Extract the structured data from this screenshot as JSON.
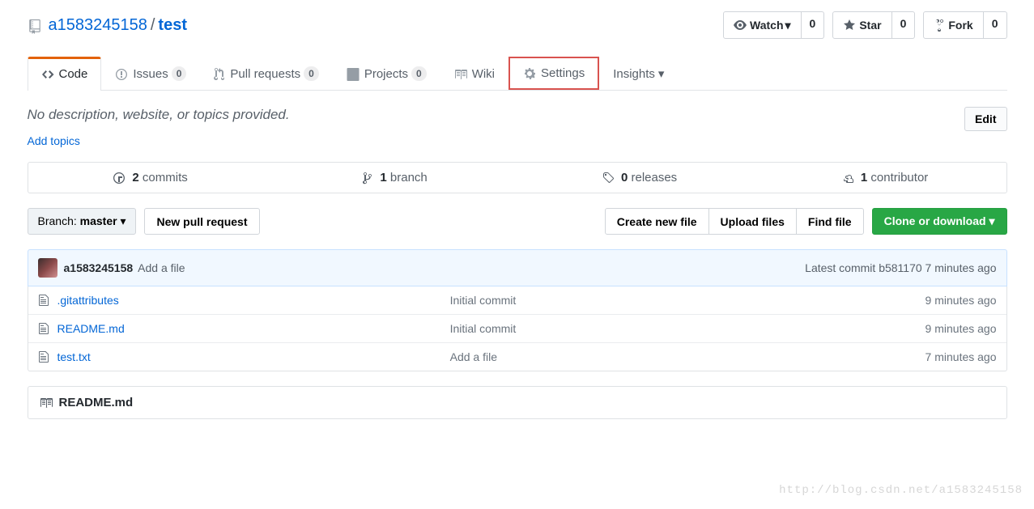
{
  "header": {
    "owner": "a1583245158",
    "sep": "/",
    "repo": "test",
    "watch_label": "Watch",
    "watch_count": "0",
    "star_label": "Star",
    "star_count": "0",
    "fork_label": "Fork",
    "fork_count": "0"
  },
  "tabs": {
    "code": "Code",
    "issues": "Issues",
    "issues_count": "0",
    "pulls": "Pull requests",
    "pulls_count": "0",
    "projects": "Projects",
    "projects_count": "0",
    "wiki": "Wiki",
    "settings": "Settings",
    "insights": "Insights"
  },
  "desc": {
    "text": "No description, website, or topics provided.",
    "edit": "Edit",
    "add_topics": "Add topics"
  },
  "stats": {
    "commits_n": "2",
    "commits_l": "commits",
    "branch_n": "1",
    "branch_l": "branch",
    "releases_n": "0",
    "releases_l": "releases",
    "contrib_n": "1",
    "contrib_l": "contributor"
  },
  "filenav": {
    "branch_prefix": "Branch: ",
    "branch_name": "master",
    "new_pr": "New pull request",
    "create_file": "Create new file",
    "upload": "Upload files",
    "find": "Find file",
    "clone": "Clone or download"
  },
  "commitbar": {
    "user": "a1583245158",
    "msg": "Add a file",
    "latest_text": "Latest commit ",
    "sha": "b581170",
    "time": " 7 minutes ago"
  },
  "files": [
    {
      "name": ".gitattributes",
      "msg": "Initial commit",
      "time": "9 minutes ago"
    },
    {
      "name": "README.md",
      "msg": "Initial commit",
      "time": "9 minutes ago"
    },
    {
      "name": "test.txt",
      "msg": "Add a file",
      "time": "7 minutes ago"
    }
  ],
  "readme": {
    "title": "README.md"
  },
  "watermark": "http://blog.csdn.net/a1583245158"
}
